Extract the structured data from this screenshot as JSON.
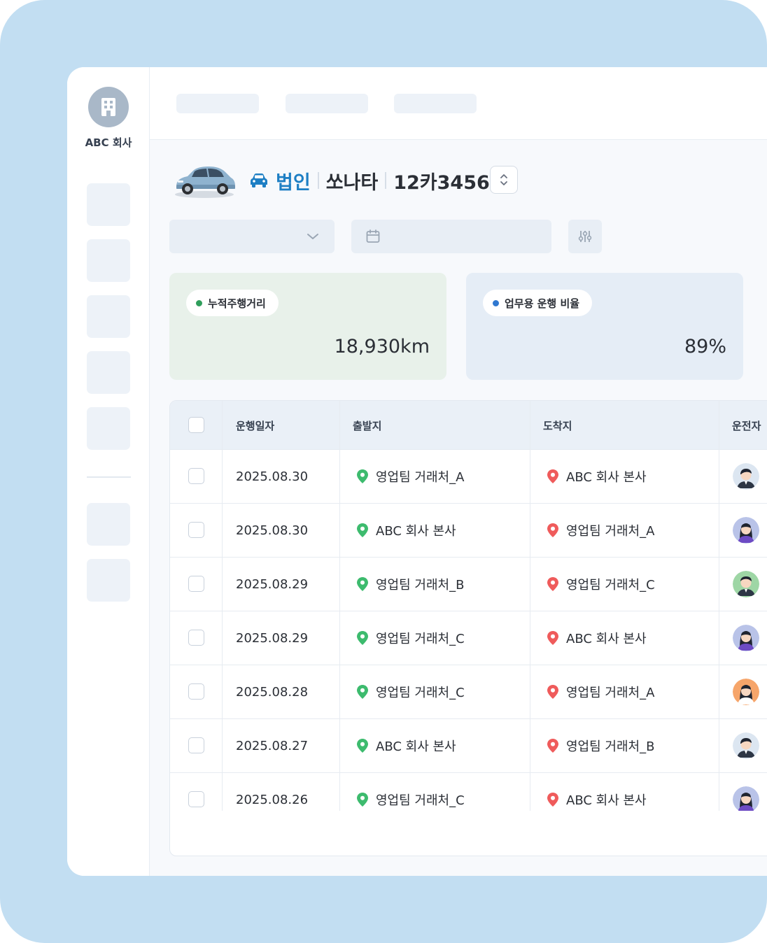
{
  "company": {
    "name": "ABC 회사"
  },
  "vehicle": {
    "type": "법인",
    "model": "쏘나타",
    "plate": "12카3456"
  },
  "stats": {
    "distance": {
      "label": "누적주행거리",
      "value": "18,930km",
      "dot_color": "#2f9e5b"
    },
    "business_ratio": {
      "label": "업무용 운행 비율",
      "value": "89%",
      "dot_color": "#2f78d0"
    }
  },
  "table": {
    "headers": {
      "date": "운행일자",
      "origin": "출발지",
      "destination": "도착지",
      "driver": "운전자"
    },
    "rows": [
      {
        "date": "2025.08.30",
        "origin": "영업팀 거래처_A",
        "destination": "ABC 회사 본사",
        "driver_avatar": "male-suit-avatar"
      },
      {
        "date": "2025.08.30",
        "origin": "ABC 회사 본사",
        "destination": "영업팀 거래처_A",
        "driver_avatar": "female-purple-avatar"
      },
      {
        "date": "2025.08.29",
        "origin": "영업팀 거래처_B",
        "destination": "영업팀 거래처_C",
        "driver_avatar": "male-green-avatar"
      },
      {
        "date": "2025.08.29",
        "origin": "영업팀 거래처_C",
        "destination": "ABC 회사 본사",
        "driver_avatar": "female-purple-avatar"
      },
      {
        "date": "2025.08.28",
        "origin": "영업팀 거래처_C",
        "destination": "영업팀 거래처_A",
        "driver_avatar": "female-orange-avatar"
      },
      {
        "date": "2025.08.27",
        "origin": "ABC 회사 본사",
        "destination": "영업팀 거래처_B",
        "driver_avatar": "male-suit-avatar"
      },
      {
        "date": "2025.08.26",
        "origin": "영업팀 거래처_C",
        "destination": "ABC 회사 본사",
        "driver_avatar": "female-purple-avatar"
      }
    ]
  },
  "colors": {
    "background": "#c2def2",
    "accent": "#1e7fc4",
    "origin_pin": "#3dbb6e",
    "destination_pin": "#ef5b5b"
  },
  "icons": {
    "company": "building-icon",
    "vehicle_type": "car-icon",
    "sort": "chevron-up-down-icon",
    "select": "chevron-down-icon",
    "date": "calendar-icon",
    "filter": "sliders-icon",
    "origin": "map-pin-green-icon",
    "destination": "map-pin-red-icon"
  }
}
